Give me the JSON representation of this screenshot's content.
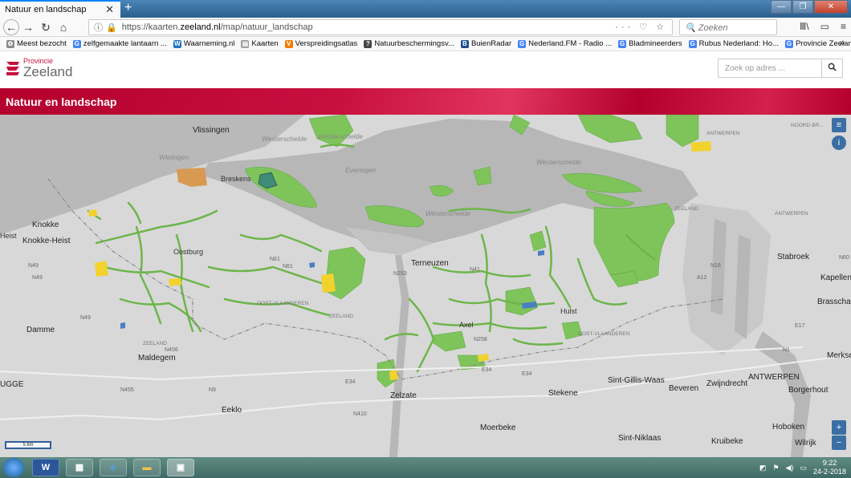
{
  "browser": {
    "tab_title": "Natuur en landschap",
    "tab_close": "✕",
    "new_tab": "+",
    "url_prefix": "https://kaarten.",
    "url_domain": "zeeland.nl",
    "url_path": "/map/natuur_landschap",
    "url_actions": "··· ♡ ☆",
    "search_placeholder": "Zoeken",
    "bookmarks": [
      {
        "label": "Meest bezocht",
        "icon_color": "#888888",
        "glyph": "✿"
      },
      {
        "label": "zelfgemaakte lantaarn ...",
        "icon_color": "#4285f4",
        "glyph": "G"
      },
      {
        "label": "Waarneming.nl",
        "icon_color": "#1e73be",
        "glyph": "W"
      },
      {
        "label": "Kaarten",
        "icon_color": "#9a9a9a",
        "glyph": "▤"
      },
      {
        "label": "Verspreidingsatlas",
        "icon_color": "#f07c00",
        "glyph": "V"
      },
      {
        "label": "Natuurbeschermingsv...",
        "icon_color": "#444444",
        "glyph": "?"
      },
      {
        "label": "BuienRadar",
        "icon_color": "#1a4d8c",
        "glyph": "B"
      },
      {
        "label": "Nederland.FM - Radio ...",
        "icon_color": "#4285f4",
        "glyph": "G"
      },
      {
        "label": "Bladmineerders",
        "icon_color": "#4285f4",
        "glyph": "G"
      },
      {
        "label": "Rubus Nederland: Ho...",
        "icon_color": "#4285f4",
        "glyph": "G"
      },
      {
        "label": "Provincie Zeeland Geo...",
        "icon_color": "#4285f4",
        "glyph": "G"
      }
    ],
    "bookmarks_more": "»"
  },
  "site": {
    "logo_provincie": "Provincie",
    "logo_zeeland": "Zeeland",
    "address_placeholder": "Zoek op adres ...",
    "search_glyph": "🔍",
    "banner_title": "Natuur en landschap"
  },
  "map": {
    "places": [
      {
        "name": "Vlissingen",
        "big": true
      },
      {
        "name": "Breskens",
        "big": false
      },
      {
        "name": "Knokke",
        "big": true
      },
      {
        "name": "Heist",
        "big": false
      },
      {
        "name": "Knokke-Heist",
        "big": true
      },
      {
        "name": "Oostburg",
        "big": false
      },
      {
        "name": "Terneuzen",
        "big": true
      },
      {
        "name": "Axel",
        "big": false
      },
      {
        "name": "Hulst",
        "big": false
      },
      {
        "name": "Damme",
        "big": true
      },
      {
        "name": "Maldegem",
        "big": true
      },
      {
        "name": "Eeklo",
        "big": true
      },
      {
        "name": "Zelzate",
        "big": true
      },
      {
        "name": "Stekene",
        "big": true
      },
      {
        "name": "Sint-Gillis-Waas",
        "big": true
      },
      {
        "name": "Beveren",
        "big": true
      },
      {
        "name": "Zwijndrecht",
        "big": true
      },
      {
        "name": "ANTWERPEN",
        "big": true
      },
      {
        "name": "Borgerhout",
        "big": true
      },
      {
        "name": "Moerbeke",
        "big": true
      },
      {
        "name": "Sint-Niklaas",
        "big": true
      },
      {
        "name": "Kruibeke",
        "big": true
      },
      {
        "name": "Hoboken",
        "big": true
      },
      {
        "name": "Wilrijk",
        "big": true
      },
      {
        "name": "Stabroek",
        "big": true
      },
      {
        "name": "Kapellen",
        "big": true
      },
      {
        "name": "Brasschaat",
        "big": true
      },
      {
        "name": "Merksem",
        "big": true
      },
      {
        "name": "UGGE",
        "big": true
      }
    ],
    "water_labels": [
      "Wielingen",
      "Westerschelde",
      "Westerschelde",
      "Everingen",
      "Westerschelde",
      "Westerschelde"
    ],
    "road_labels": [
      "N61",
      "N61",
      "N258",
      "N253",
      "N49",
      "N49",
      "N9",
      "E34",
      "E34",
      "E17",
      "N41",
      "N16",
      "A12",
      "N1",
      "N456",
      "N455",
      "N410",
      "N49",
      "E34",
      "N60"
    ],
    "region_labels": [
      "ZEELAND",
      "OOST-VLAANDEREN",
      "OOST-VLAANDEREN",
      "ZEELAND",
      "ZEELAND",
      "ANTWERPEN",
      "ANTWERPEN",
      "NOORD-BR..."
    ],
    "scale_label": "5 km",
    "zoom_in": "+",
    "zoom_out": "−",
    "layers_glyph": "≡",
    "info_glyph": "i",
    "colors": {
      "land": "#dcdcdc",
      "water": "#b7b7b7",
      "nature": "#7ec45a",
      "nature_dark": "#5da43f",
      "yellow": "#f2d22c",
      "orange": "#d89a52",
      "teal": "#3f8a78",
      "blue": "#4a7fc1"
    }
  },
  "taskbar": {
    "time": "9:22",
    "date": "24-2-2018",
    "apps": [
      "W",
      "▦",
      "e",
      "▬",
      "▣"
    ]
  }
}
